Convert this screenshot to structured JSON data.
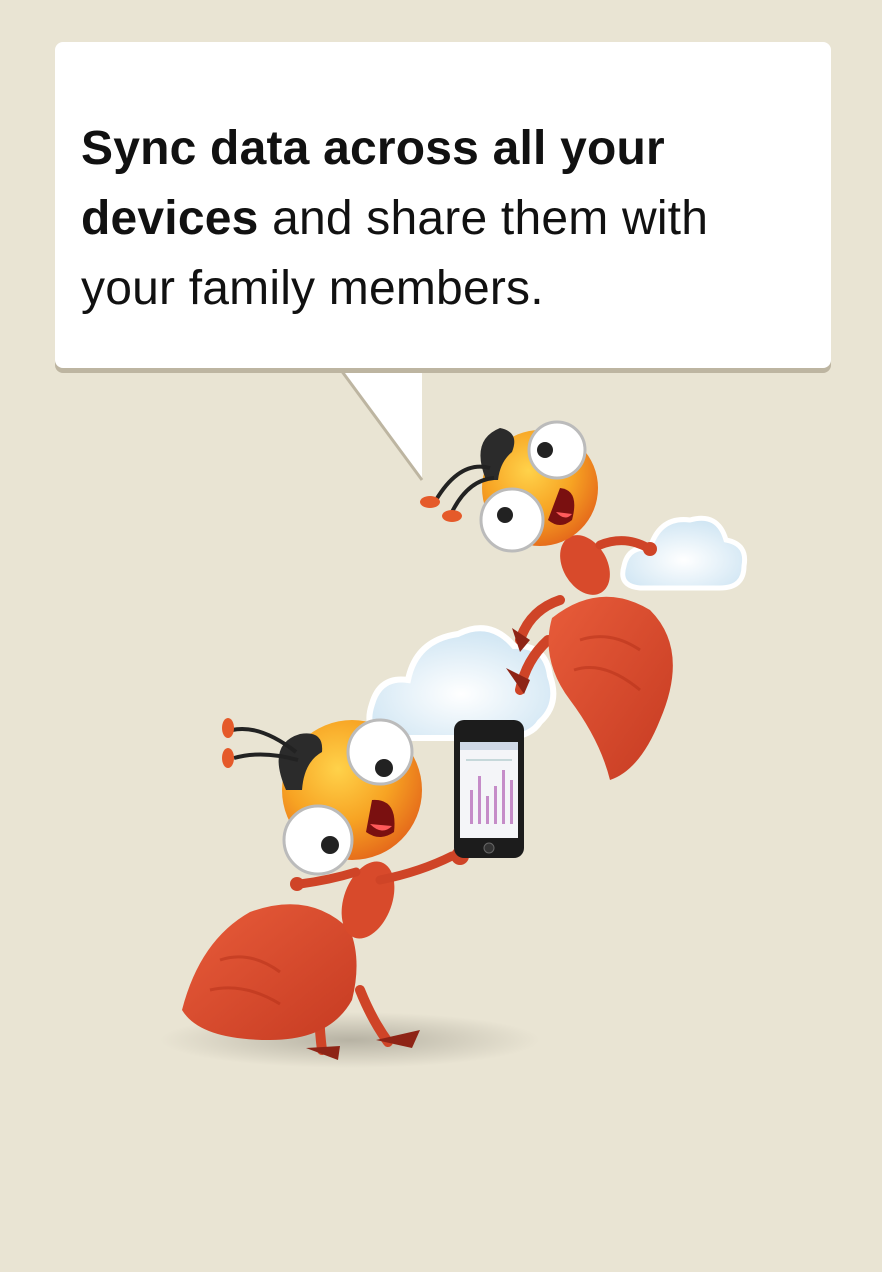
{
  "message": {
    "bold_part": "Sync data across all your devices",
    "normal_part": " and share them with your family members."
  },
  "illustration": {
    "characters": [
      "ant-top",
      "ant-bottom"
    ],
    "props": [
      "cloud-small",
      "cloud-large",
      "smartphone"
    ]
  },
  "colors": {
    "background": "#e9e4d3",
    "bubble": "#ffffff",
    "ant_body": "#d7462a",
    "ant_head": "#f39a1e",
    "cloud": "#dcecf6"
  }
}
